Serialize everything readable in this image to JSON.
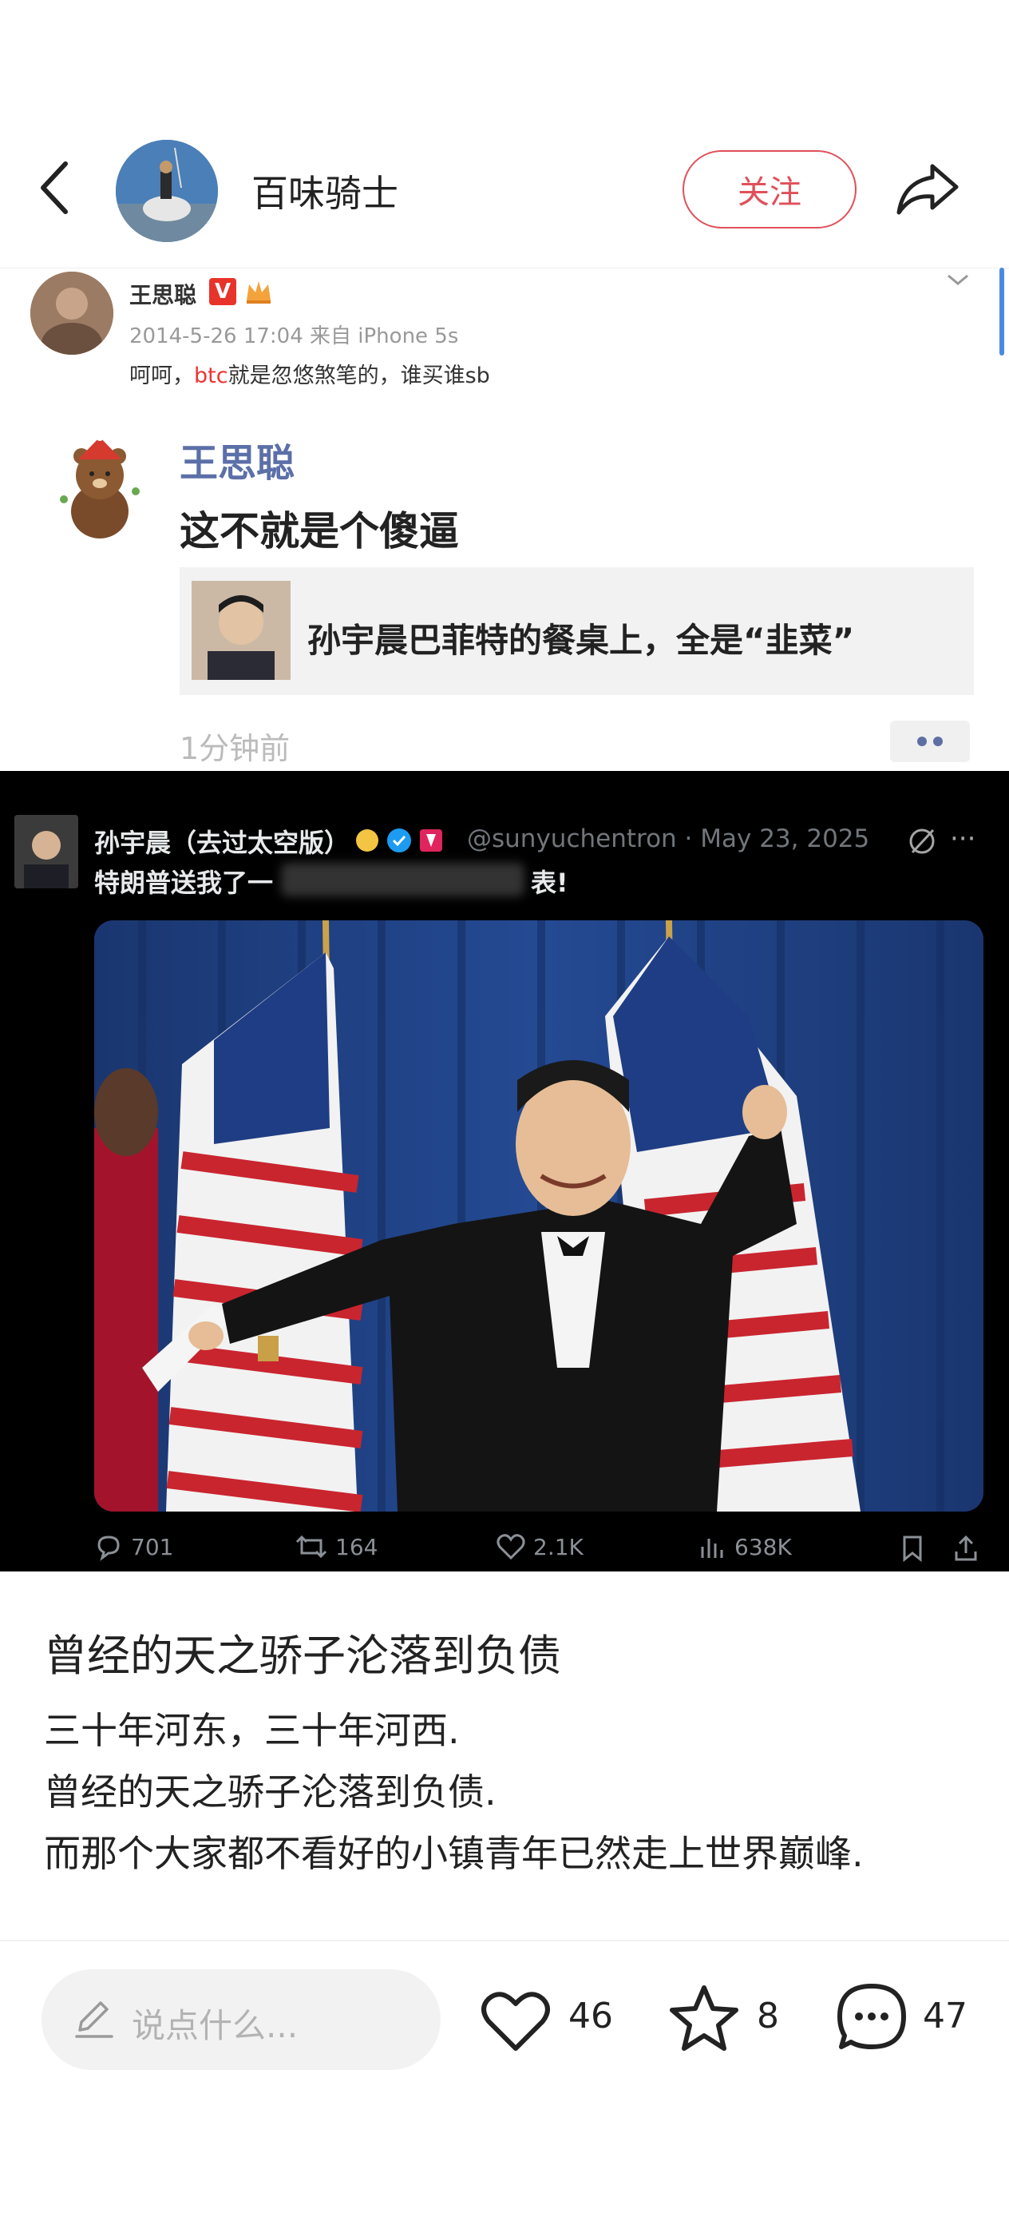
{
  "header": {
    "author": "百味骑士",
    "follow_label": "关注"
  },
  "weibo": {
    "name": "王思聪",
    "v_badge": "V",
    "meta": "2014-5-26 17:04 来自 iPhone 5s",
    "text_before": "呵呵，",
    "text_btc": "btc",
    "text_after": "就是忽悠煞笔的，谁买谁sb",
    "reply_name": "王思聪",
    "reply_text": "这不就是个傻逼",
    "quote_text": "孙宇晨巴菲特的餐桌上，全是“韭菜”",
    "time_ago": "1分钟前"
  },
  "tweet": {
    "name": "孙宇晨（去过太空版）",
    "handle": "@sunyuchentron · May 23, 2025",
    "text_start": "特朗普送我了一",
    "text_end": "表!",
    "more": "···",
    "actions": {
      "replies": "701",
      "retweets": "164",
      "likes": "2.1K",
      "views": "638K"
    }
  },
  "article": {
    "title": "曾经的天之骄子沦落到负债",
    "line1": "三十年河东，三十年河西.",
    "line2": "曾经的天之骄子沦落到负债.",
    "line3": "而那个大家都不看好的小镇青年已然走上世界巅峰."
  },
  "bottom_bar": {
    "comment_placeholder": "说点什么...",
    "likes": "46",
    "favorites": "8",
    "comments": "47"
  },
  "colors": {
    "follow_red": "#e0505a",
    "weibo_blue_name": "#5b6fa8",
    "tweet_bg": "#000000"
  }
}
